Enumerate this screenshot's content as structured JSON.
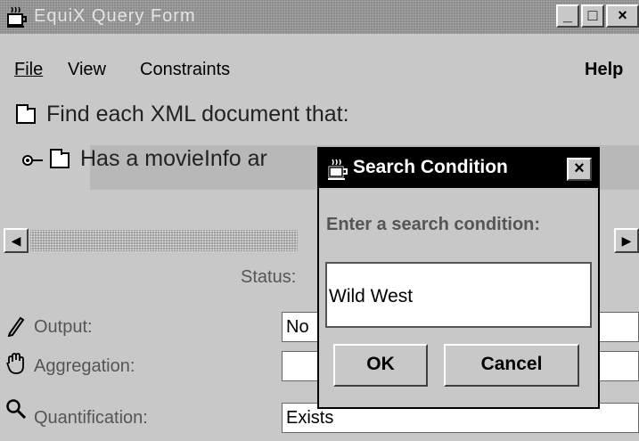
{
  "window": {
    "title": "EquiX Query Form",
    "buttons": {
      "minimize": "_",
      "maximize": "□",
      "close": "×"
    }
  },
  "menubar": {
    "file": "File",
    "view": "View",
    "constraints": "Constraints",
    "help": "Help"
  },
  "tree": {
    "root_label": "Find each XML document that:",
    "child_label": "Has a movieInfo ar"
  },
  "scrollbar": {
    "left_arrow": "◀",
    "right_arrow": "▶"
  },
  "properties": {
    "status_label": "Status:",
    "output_label": "Output:",
    "output_value": "No",
    "aggregation_label": "Aggregation:",
    "aggregation_value": "",
    "quantification_label": "Quantification:",
    "quantification_value": "Exists"
  },
  "dialog": {
    "title": "Search Condition",
    "close": "×",
    "prompt": "Enter a search condition:",
    "input_value": "Wild West",
    "ok_label": "OK",
    "cancel_label": "Cancel"
  },
  "icons": {
    "app_icon": "coffee-cup-icon",
    "output_icon": "pencil-icon",
    "aggregation_icon": "hand-icon",
    "quantification_icon": "magnifier-icon"
  }
}
